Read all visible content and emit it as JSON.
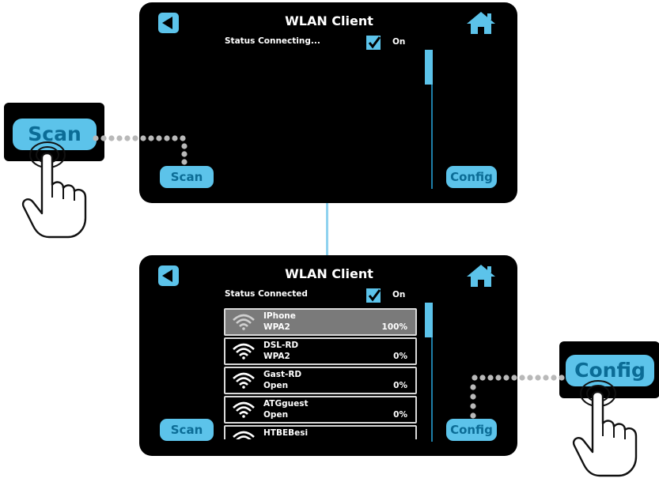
{
  "top_screen": {
    "title": "WLAN Client",
    "status": "Status Connecting...",
    "on_label": "On",
    "scan_label": "Scan",
    "config_label": "Config"
  },
  "bottom_screen": {
    "title": "WLAN Client",
    "status": "Status Connected",
    "on_label": "On",
    "scan_label": "Scan",
    "config_label": "Config",
    "networks": [
      {
        "name": "IPhone",
        "security": "WPA2",
        "signal": "100%",
        "selected": true
      },
      {
        "name": "DSL-RD",
        "security": "WPA2",
        "signal": "0%"
      },
      {
        "name": "Gast-RD",
        "security": "Open",
        "signal": "0%"
      },
      {
        "name": "ATGguest",
        "security": "Open",
        "signal": "0%"
      },
      {
        "name": "HTBEBesi",
        "security": "",
        "signal": ""
      }
    ]
  },
  "callouts": {
    "scan_label": "Scan",
    "config_label": "Config"
  },
  "icons": {
    "back": "back-arrow-icon",
    "home": "home-icon",
    "wifi": "wifi-icon",
    "check": "checkmark-icon",
    "hand": "tapping-hand-icon"
  },
  "colors": {
    "accent": "#5cc3ea",
    "button_text": "#0b6c96",
    "screen_bg": "#000000",
    "selected_row": "#7a7a7a"
  }
}
